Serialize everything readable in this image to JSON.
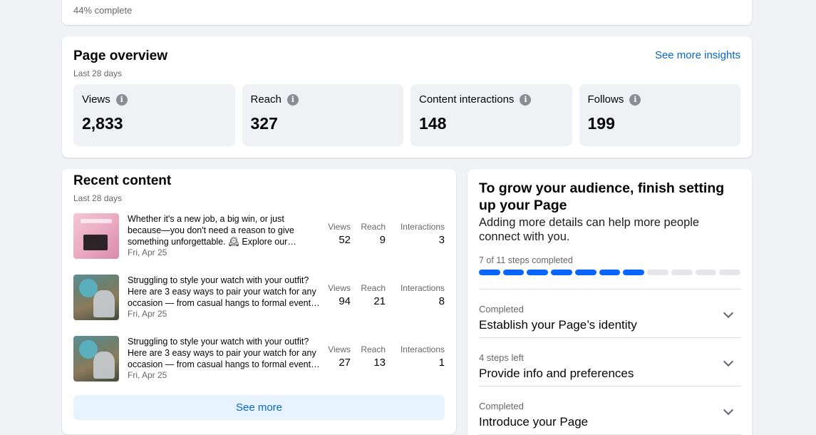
{
  "top": {
    "progress_text": "44% complete"
  },
  "overview": {
    "title": "Page overview",
    "subtitle": "Last 28 days",
    "link": "See more insights",
    "metrics": [
      {
        "label": "Views",
        "value": "2,833"
      },
      {
        "label": "Reach",
        "value": "327"
      },
      {
        "label": "Content interactions",
        "value": "148"
      },
      {
        "label": "Follows",
        "value": "199"
      }
    ],
    "info_icon": "info-icon"
  },
  "recent": {
    "title": "Recent content",
    "subtitle": "Last 28 days",
    "stat_labels": {
      "views": "Views",
      "reach": "Reach",
      "interactions": "Interactions"
    },
    "posts": [
      {
        "text": "Whether it's a new job, a big win, or just because—you don't need a reason to give something unforgettable. 🕰 Explore our…",
        "date": "Fri, Apr 25",
        "views": "52",
        "reach": "9",
        "interactions": "3",
        "thumb": "gift-box-thumbnail"
      },
      {
        "text": "Struggling to style your watch with your outfit? Here are 3 easy ways to pair your watch for any occasion — from casual hangs to formal event…",
        "date": "Fri, Apr 25",
        "views": "94",
        "reach": "21",
        "interactions": "8",
        "thumb": "watch-styling-thumbnail"
      },
      {
        "text": "Struggling to style your watch with your outfit? Here are 3 easy ways to pair your watch for any occasion — from casual hangs to formal event…",
        "date": "Fri, Apr 25",
        "views": "27",
        "reach": "13",
        "interactions": "1",
        "thumb": "watch-styling-thumbnail"
      }
    ],
    "see_more": "See more"
  },
  "grow": {
    "title": "To grow your audience, finish setting up your Page",
    "subtitle": "Adding more details can help more people connect with you.",
    "steps_text": "7 of 11 steps completed",
    "steps_completed": 7,
    "steps_total": 11,
    "accent_color": "#0866ff",
    "sections": [
      {
        "status": "Completed",
        "name": "Establish your Page’s identity"
      },
      {
        "status": "4 steps left",
        "name": "Provide info and preferences"
      },
      {
        "status": "Completed",
        "name": "Introduce your Page"
      }
    ]
  }
}
